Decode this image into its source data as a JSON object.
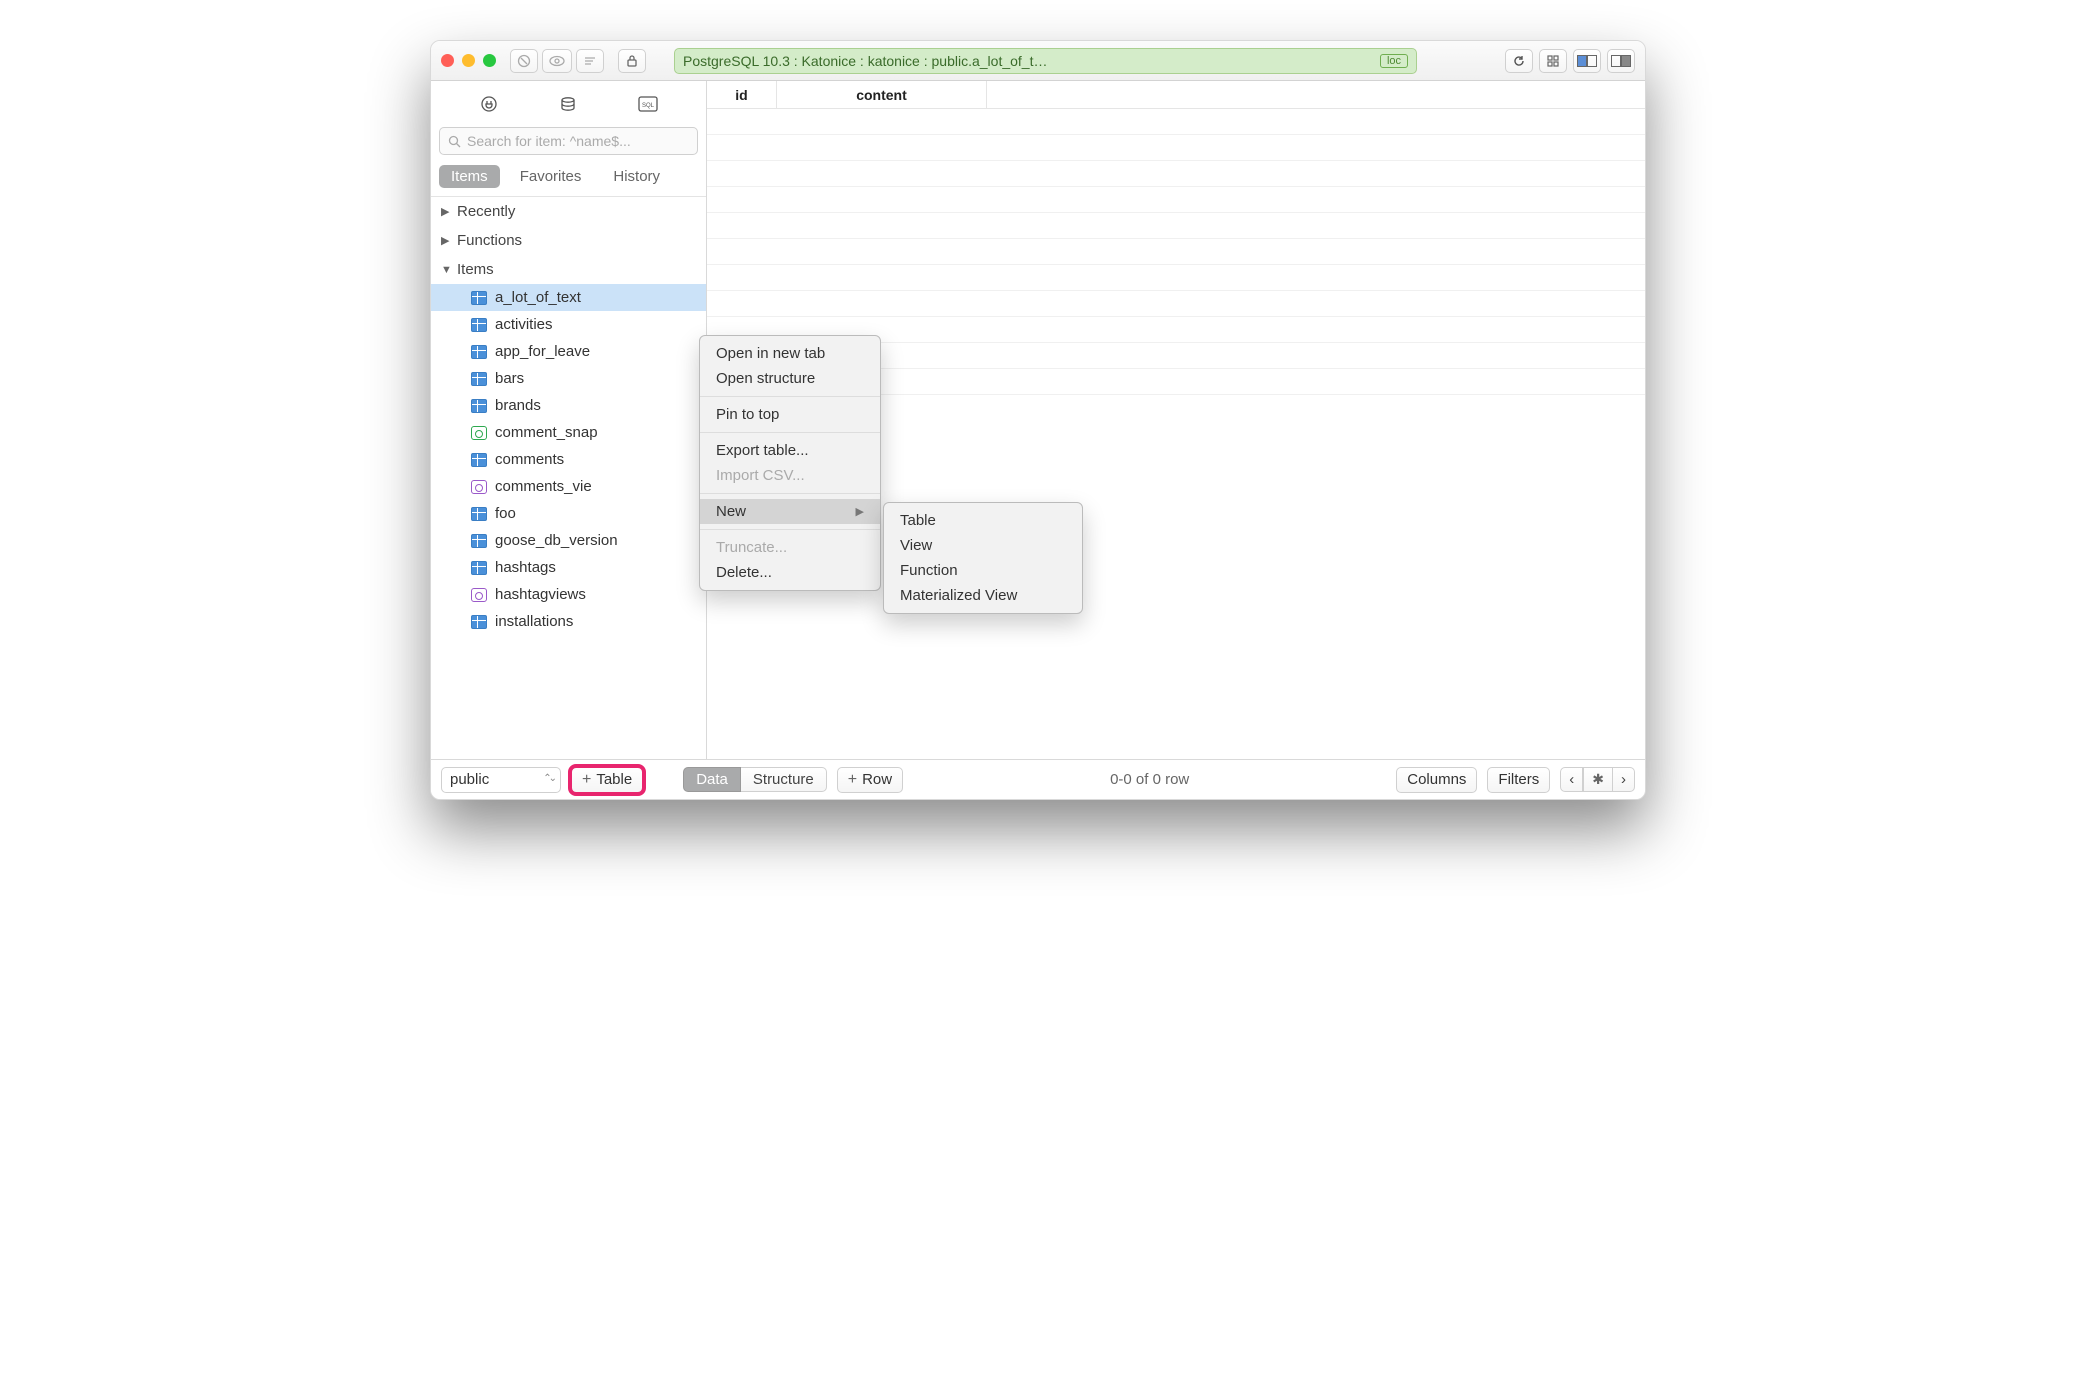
{
  "breadcrumb": "PostgreSQL 10.3 : Katonice : katonice : public.a_lot_of_t…",
  "loc_badge": "loc",
  "search_placeholder": "Search for item: ^name$...",
  "sidebar_tabs": {
    "items": "Items",
    "favorites": "Favorites",
    "history": "History"
  },
  "tree": {
    "recently": "Recently",
    "functions": "Functions",
    "items_label": "Items",
    "items": [
      {
        "name": "a_lot_of_text",
        "icon": "table",
        "selected": true
      },
      {
        "name": "activities",
        "icon": "table"
      },
      {
        "name": "app_for_leave",
        "icon": "table"
      },
      {
        "name": "bars",
        "icon": "table"
      },
      {
        "name": "brands",
        "icon": "table"
      },
      {
        "name": "comment_snap",
        "icon": "view"
      },
      {
        "name": "comments",
        "icon": "table"
      },
      {
        "name": "comments_vie",
        "icon": "mview"
      },
      {
        "name": "foo",
        "icon": "table"
      },
      {
        "name": "goose_db_version",
        "icon": "table"
      },
      {
        "name": "hashtags",
        "icon": "table"
      },
      {
        "name": "hashtagviews",
        "icon": "mview"
      },
      {
        "name": "installations",
        "icon": "table"
      }
    ]
  },
  "columns": {
    "id": "id",
    "content": "content"
  },
  "context_menu": {
    "open_tab": "Open in new tab",
    "open_structure": "Open structure",
    "pin": "Pin to top",
    "export": "Export table...",
    "import": "Import CSV...",
    "new": "New",
    "truncate": "Truncate...",
    "delete": "Delete..."
  },
  "submenu": {
    "table": "Table",
    "view": "View",
    "function": "Function",
    "mview": "Materialized View"
  },
  "footer": {
    "schema": "public",
    "add_table": "Table",
    "data": "Data",
    "structure": "Structure",
    "row": "Row",
    "status": "0-0 of 0 row",
    "columns": "Columns",
    "filters": "Filters"
  }
}
